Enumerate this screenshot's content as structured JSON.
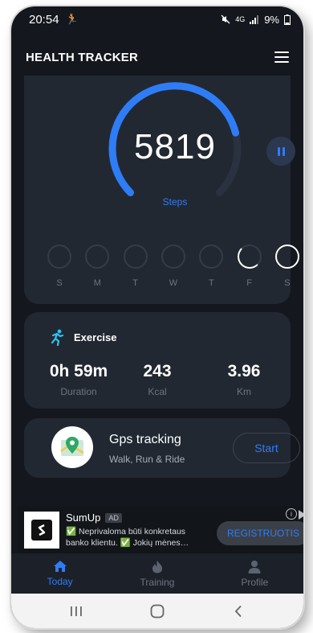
{
  "status_bar": {
    "time": "20:54",
    "battery": "9%",
    "network": "4G"
  },
  "header": {
    "title": "HEALTH TRACKER"
  },
  "steps": {
    "count": "5819",
    "label": "Steps",
    "progress": 0.78
  },
  "week": {
    "days": [
      {
        "label": "S",
        "state": "empty"
      },
      {
        "label": "M",
        "state": "empty"
      },
      {
        "label": "T",
        "state": "empty"
      },
      {
        "label": "W",
        "state": "empty"
      },
      {
        "label": "T",
        "state": "empty"
      },
      {
        "label": "F",
        "state": "partial"
      },
      {
        "label": "S",
        "state": "full"
      }
    ]
  },
  "exercise": {
    "title": "Exercise",
    "stats": [
      {
        "value": "0h 59m",
        "unit": "Duration"
      },
      {
        "value": "243",
        "unit": "Kcal"
      },
      {
        "value": "3.96",
        "unit": "Km"
      }
    ]
  },
  "gps": {
    "title": "Gps tracking",
    "subtitle": "Walk, Run & Ride",
    "button": "Start"
  },
  "ad": {
    "name": "SumUp",
    "badge": "AD",
    "text": "✅ Neprivaloma būti konkretaus banko klientu. ✅ Jokių mėnes…",
    "cta": "REGISTRUOTIS"
  },
  "nav": [
    {
      "label": "Today",
      "icon": "home-icon",
      "active": true
    },
    {
      "label": "Training",
      "icon": "flame-icon",
      "active": false
    },
    {
      "label": "Profile",
      "icon": "person-icon",
      "active": false
    }
  ],
  "colors": {
    "accent": "#2e7df6",
    "background": "#14171d",
    "card": "#222832"
  }
}
